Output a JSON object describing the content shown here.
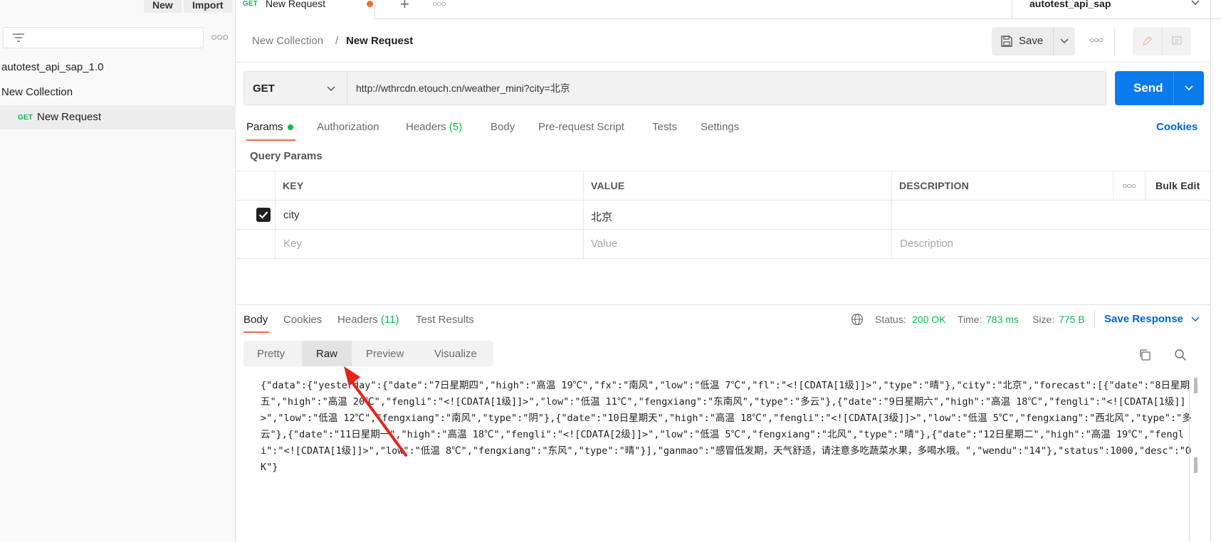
{
  "sidebar": {
    "new_label": "New",
    "import_label": "Import",
    "filter_placeholder": "",
    "workspace": "autotest_api_sap_1.0",
    "collection": "New Collection",
    "request_method": "GET",
    "request_name": "New Request"
  },
  "tabbar": {
    "tab_method": "GET",
    "tab_name": "New Request",
    "environment": "autotest_api_sap"
  },
  "breadcrumb": {
    "collection": "New Collection",
    "separator": "/",
    "request": "New Request",
    "save_label": "Save"
  },
  "request": {
    "method": "GET",
    "url": "http://wthrcdn.etouch.cn/weather_mini?city=北京",
    "send_label": "Send"
  },
  "req_tabs": {
    "params": "Params",
    "authorization": "Authorization",
    "headers": "Headers",
    "headers_count": "(5)",
    "body": "Body",
    "prerequest": "Pre-request Script",
    "tests": "Tests",
    "settings": "Settings",
    "cookies": "Cookies"
  },
  "params": {
    "title": "Query Params",
    "col_key": "KEY",
    "col_value": "VALUE",
    "col_description": "DESCRIPTION",
    "bulk_edit": "Bulk Edit",
    "row_key": "city",
    "row_value": "北京",
    "key_placeholder": "Key",
    "value_placeholder": "Value",
    "description_placeholder": "Description"
  },
  "response": {
    "tab_body": "Body",
    "tab_cookies": "Cookies",
    "tab_headers": "Headers",
    "headers_count": "(11)",
    "tab_test_results": "Test Results",
    "status_label": "Status:",
    "status_value": "200 OK",
    "time_label": "Time:",
    "time_value": "783 ms",
    "size_label": "Size:",
    "size_value": "775 B",
    "save_response": "Save Response",
    "views": {
      "pretty": "Pretty",
      "raw": "Raw",
      "preview": "Preview",
      "visualize": "Visualize"
    },
    "raw_body": "{\"data\":{\"yesterday\":{\"date\":\"7日星期四\",\"high\":\"高温 19℃\",\"fx\":\"南风\",\"low\":\"低温 7℃\",\"fl\":\"<![CDATA[1级]]>\",\"type\":\"晴\"},\"city\":\"北京\",\"forecast\":[{\"date\":\"8日星期五\",\"high\":\"高温 20℃\",\"fengli\":\"<![CDATA[1级]]>\",\"low\":\"低温 11℃\",\"fengxiang\":\"东南风\",\"type\":\"多云\"},{\"date\":\"9日星期六\",\"high\":\"高温 18℃\",\"fengli\":\"<![CDATA[1级]]>\",\"low\":\"低温 12℃\",\"fengxiang\":\"南风\",\"type\":\"阴\"},{\"date\":\"10日星期天\",\"high\":\"高温 18℃\",\"fengli\":\"<![CDATA[3级]]>\",\"low\":\"低温 5℃\",\"fengxiang\":\"西北风\",\"type\":\"多云\"},{\"date\":\"11日星期一\",\"high\":\"高温 18℃\",\"fengli\":\"<![CDATA[2级]]>\",\"low\":\"低温 5℃\",\"fengxiang\":\"北风\",\"type\":\"晴\"},{\"date\":\"12日星期二\",\"high\":\"高温 19℃\",\"fengli\":\"<![CDATA[1级]]>\",\"low\":\"低温 8℃\",\"fengxiang\":\"东风\",\"type\":\"晴\"}],\"ganmao\":\"感冒低发期，天气舒适，请注意多吃蔬菜水果，多喝水哦。\",\"wendu\":\"14\"},\"status\":1000,\"desc\":\"OK\"}"
  },
  "colors": {
    "accent_orange": "#f26b3a",
    "send_blue": "#097bed",
    "link_blue": "#0265d2",
    "status_green": "#0cbb52",
    "annotation_red": "#e8231b"
  }
}
